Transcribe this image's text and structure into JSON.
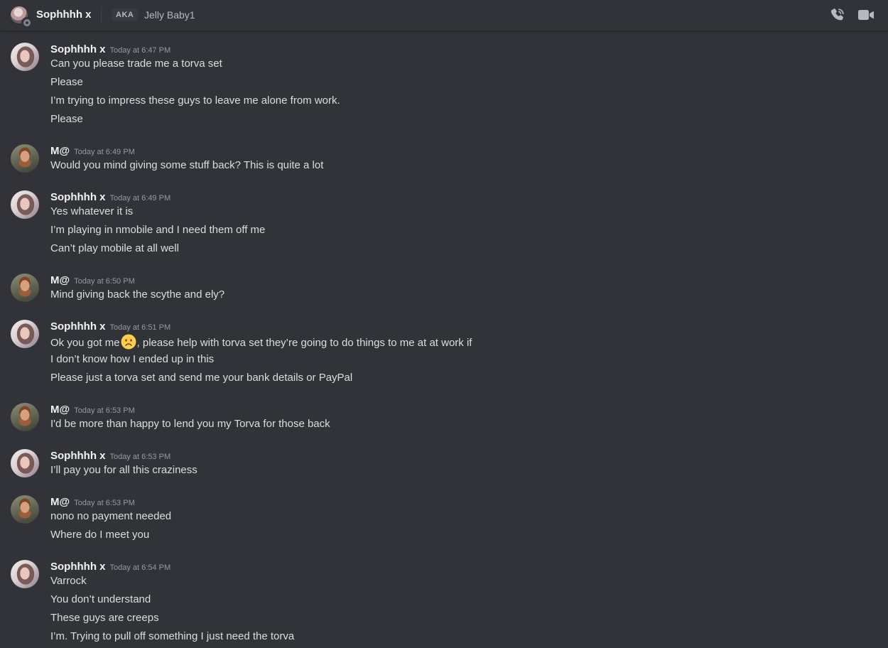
{
  "header": {
    "title": "Sophhhh x",
    "aka_label": "AKA",
    "alias": "Jelly Baby1",
    "icons": [
      "voice-call-icon",
      "video-call-icon"
    ]
  },
  "messages": [
    {
      "author": "Sophhhh x",
      "timestamp": "Today at 6:47 PM",
      "lines": [
        "Can you please trade me a torva set",
        "Please",
        "I’m trying to impress these guys to leave me alone from work.",
        "Please"
      ]
    },
    {
      "author": "M@",
      "timestamp": "Today at 6:49 PM",
      "lines": [
        "Would you mind giving some stuff back? This is quite a lot"
      ]
    },
    {
      "author": "Sophhhh x",
      "timestamp": "Today at 6:49 PM",
      "lines": [
        "Yes whatever it is",
        "I’m playing in nmobile and I need them off me",
        "Can’t play mobile at all well"
      ]
    },
    {
      "author": "M@",
      "timestamp": "Today at 6:50 PM",
      "lines": [
        "Mind giving back the scythe and ely?"
      ]
    },
    {
      "author": "Sophhhh x",
      "timestamp": "Today at 6:51 PM",
      "lines": [
        {
          "before": "Ok you got me",
          "emoji": "worried-face",
          "after": ", please help with torva set they’re going to do things to me at at work if"
        },
        "I don’t know how I ended up in this",
        "Please just a torva set and send me your bank details or PayPal"
      ]
    },
    {
      "author": "M@",
      "timestamp": "Today at 6:53 PM",
      "lines": [
        "I'd be more than happy to lend you my Torva for those back"
      ]
    },
    {
      "author": "Sophhhh x",
      "timestamp": "Today at 6:53 PM",
      "lines": [
        "I’ll pay you for all this craziness"
      ]
    },
    {
      "author": "M@",
      "timestamp": "Today at 6:53 PM",
      "lines": [
        "nono no payment needed",
        "Where do I meet you"
      ]
    },
    {
      "author": "Sophhhh x",
      "timestamp": "Today at 6:54 PM",
      "lines": [
        "Varrock",
        "You don’t understand",
        "These guys are creeps",
        "I’m. Trying to pull off something I just need the torva"
      ]
    }
  ]
}
